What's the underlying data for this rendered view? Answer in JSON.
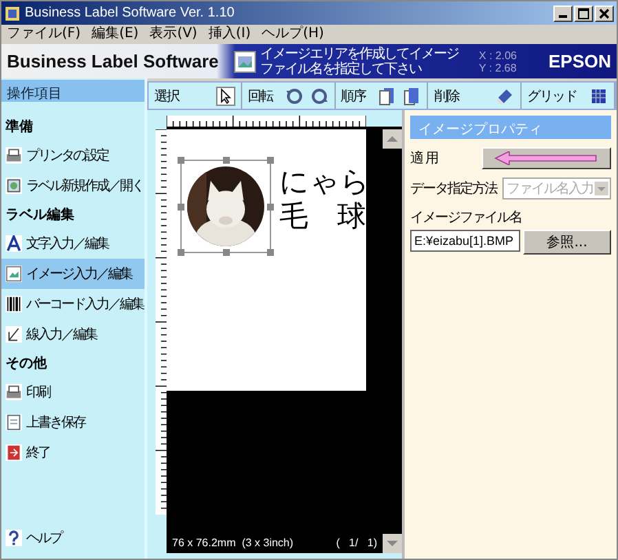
{
  "window": {
    "title": "Business Label Software Ver. 1.10"
  },
  "menu": [
    "ファイル(F)",
    "編集(E)",
    "表示(V)",
    "挿入(I)",
    "ヘルプ(H)"
  ],
  "banner": {
    "title": "Business Label Software",
    "message": "イメージエリアを作成してイメージファイル名を指定して下さい",
    "x": "X : 2.06",
    "y": "Y : 2.68",
    "brand": "EPSON"
  },
  "sidebar": {
    "header": "操作項目",
    "sections": [
      {
        "title": "準備",
        "items": [
          {
            "label": "プリンタの設定",
            "selected": false
          },
          {
            "label": "ラベル新規作成／開く",
            "selected": false
          }
        ]
      },
      {
        "title": "ラベル編集",
        "items": [
          {
            "label": "文字入力／編集",
            "selected": false
          },
          {
            "label": "イメージ入力／編集",
            "selected": true
          },
          {
            "label": "バーコード入力／編集",
            "selected": false
          },
          {
            "label": "線入力／編集",
            "selected": false
          }
        ]
      },
      {
        "title": "その他",
        "items": [
          {
            "label": "印刷",
            "selected": false
          },
          {
            "label": "上書き保存",
            "selected": false
          },
          {
            "label": "終了",
            "selected": false
          }
        ]
      }
    ],
    "help": "ヘルプ"
  },
  "toolbar": [
    {
      "label": "選択",
      "kind": "select"
    },
    {
      "label": "回転",
      "kind": "rotate"
    },
    {
      "label": "順序",
      "kind": "order"
    },
    {
      "label": "削除",
      "kind": "delete"
    },
    {
      "label": "グリッド",
      "kind": "grid"
    }
  ],
  "canvas": {
    "lines": [
      "にゃら",
      "毛　球"
    ],
    "size": "76 x 76.2mm  (3 x 3inch)",
    "page": "(   1/   1)"
  },
  "properties": {
    "header": "イメージプロパティ",
    "apply": "適 用",
    "method_label": "データ指定方法",
    "method_value": "ファイル名入力",
    "method_disabled": true,
    "file_label": "イメージファイル名",
    "file_value": "E:¥eizabu[1].BMP",
    "browse": "参照..."
  }
}
